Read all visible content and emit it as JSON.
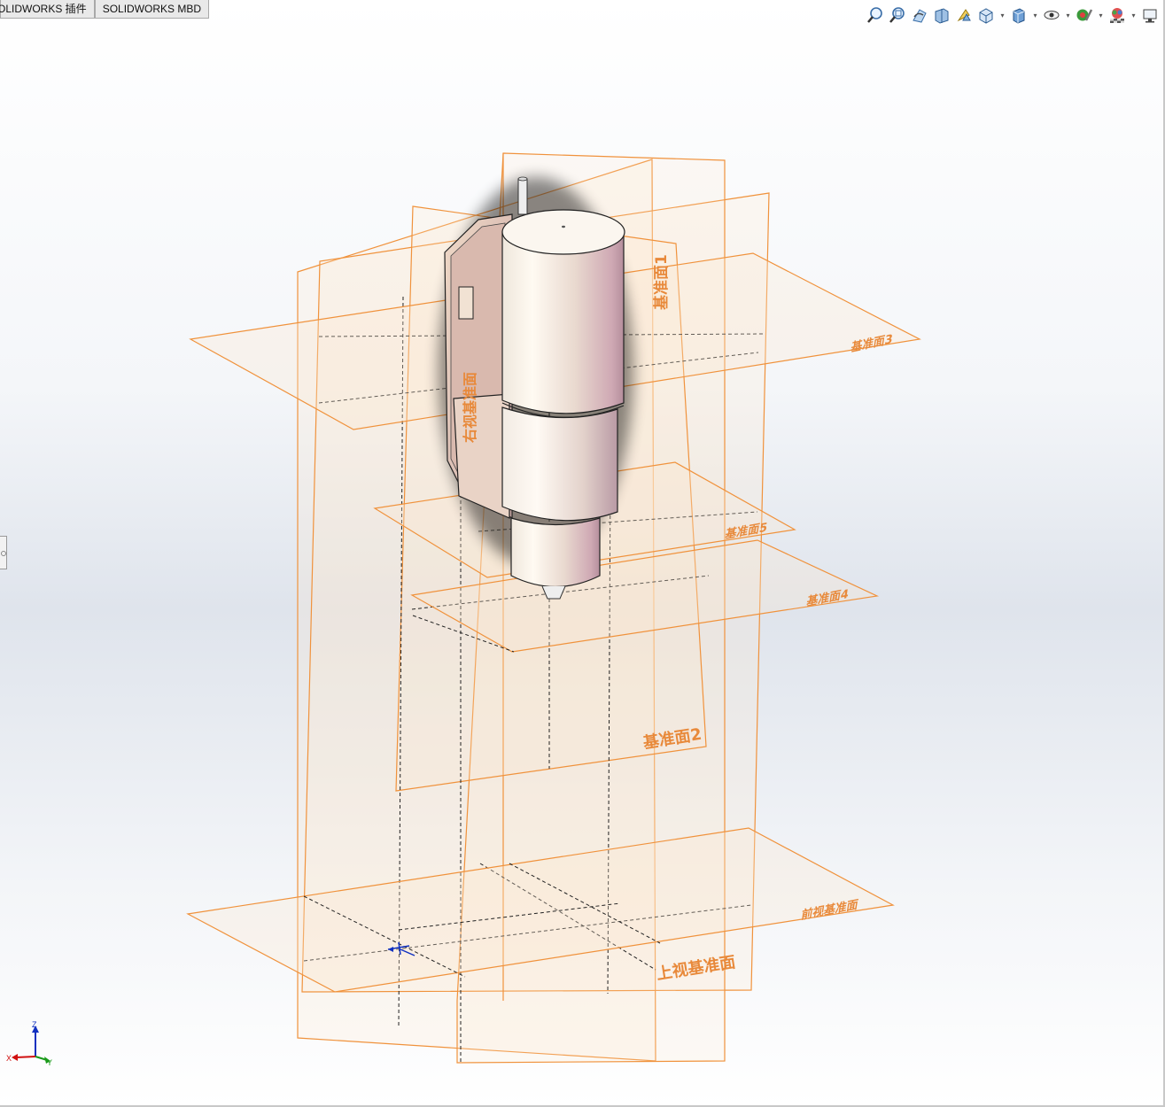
{
  "tabs": [
    {
      "label": "OLIDWORKS 插件"
    },
    {
      "label": "SOLIDWORKS MBD"
    }
  ],
  "heads_up_toolbar": [
    {
      "icon": "zoom-to-fit-icon"
    },
    {
      "icon": "zoom-to-area-icon"
    },
    {
      "icon": "previous-view-icon"
    },
    {
      "icon": "section-view-icon"
    },
    {
      "icon": "dynamic-annotation-views-icon"
    },
    {
      "icon": "view-orientation-icon"
    },
    {
      "icon": "display-style-icon"
    },
    {
      "icon": "hide-show-items-icon"
    },
    {
      "icon": "edit-appearance-icon"
    },
    {
      "icon": "apply-scene-icon"
    },
    {
      "icon": "view-settings-icon"
    }
  ],
  "planes": {
    "plane1": "基准面1",
    "plane2": "基准面2",
    "plane3": "基准面3",
    "plane4": "基准面4",
    "plane5": "基准面5",
    "top": "上视基准面",
    "front": "前视基准面",
    "right": "右视基准面"
  },
  "triad": {
    "x": "X",
    "y": "Y",
    "z": "Z"
  },
  "colors": {
    "plane_edge": "#f0923c",
    "plane_fill": "#fde3c6",
    "label": "#e8893a",
    "triad_x": "#d01010",
    "triad_y": "#1a9a1a",
    "triad_z": "#1030c0"
  }
}
